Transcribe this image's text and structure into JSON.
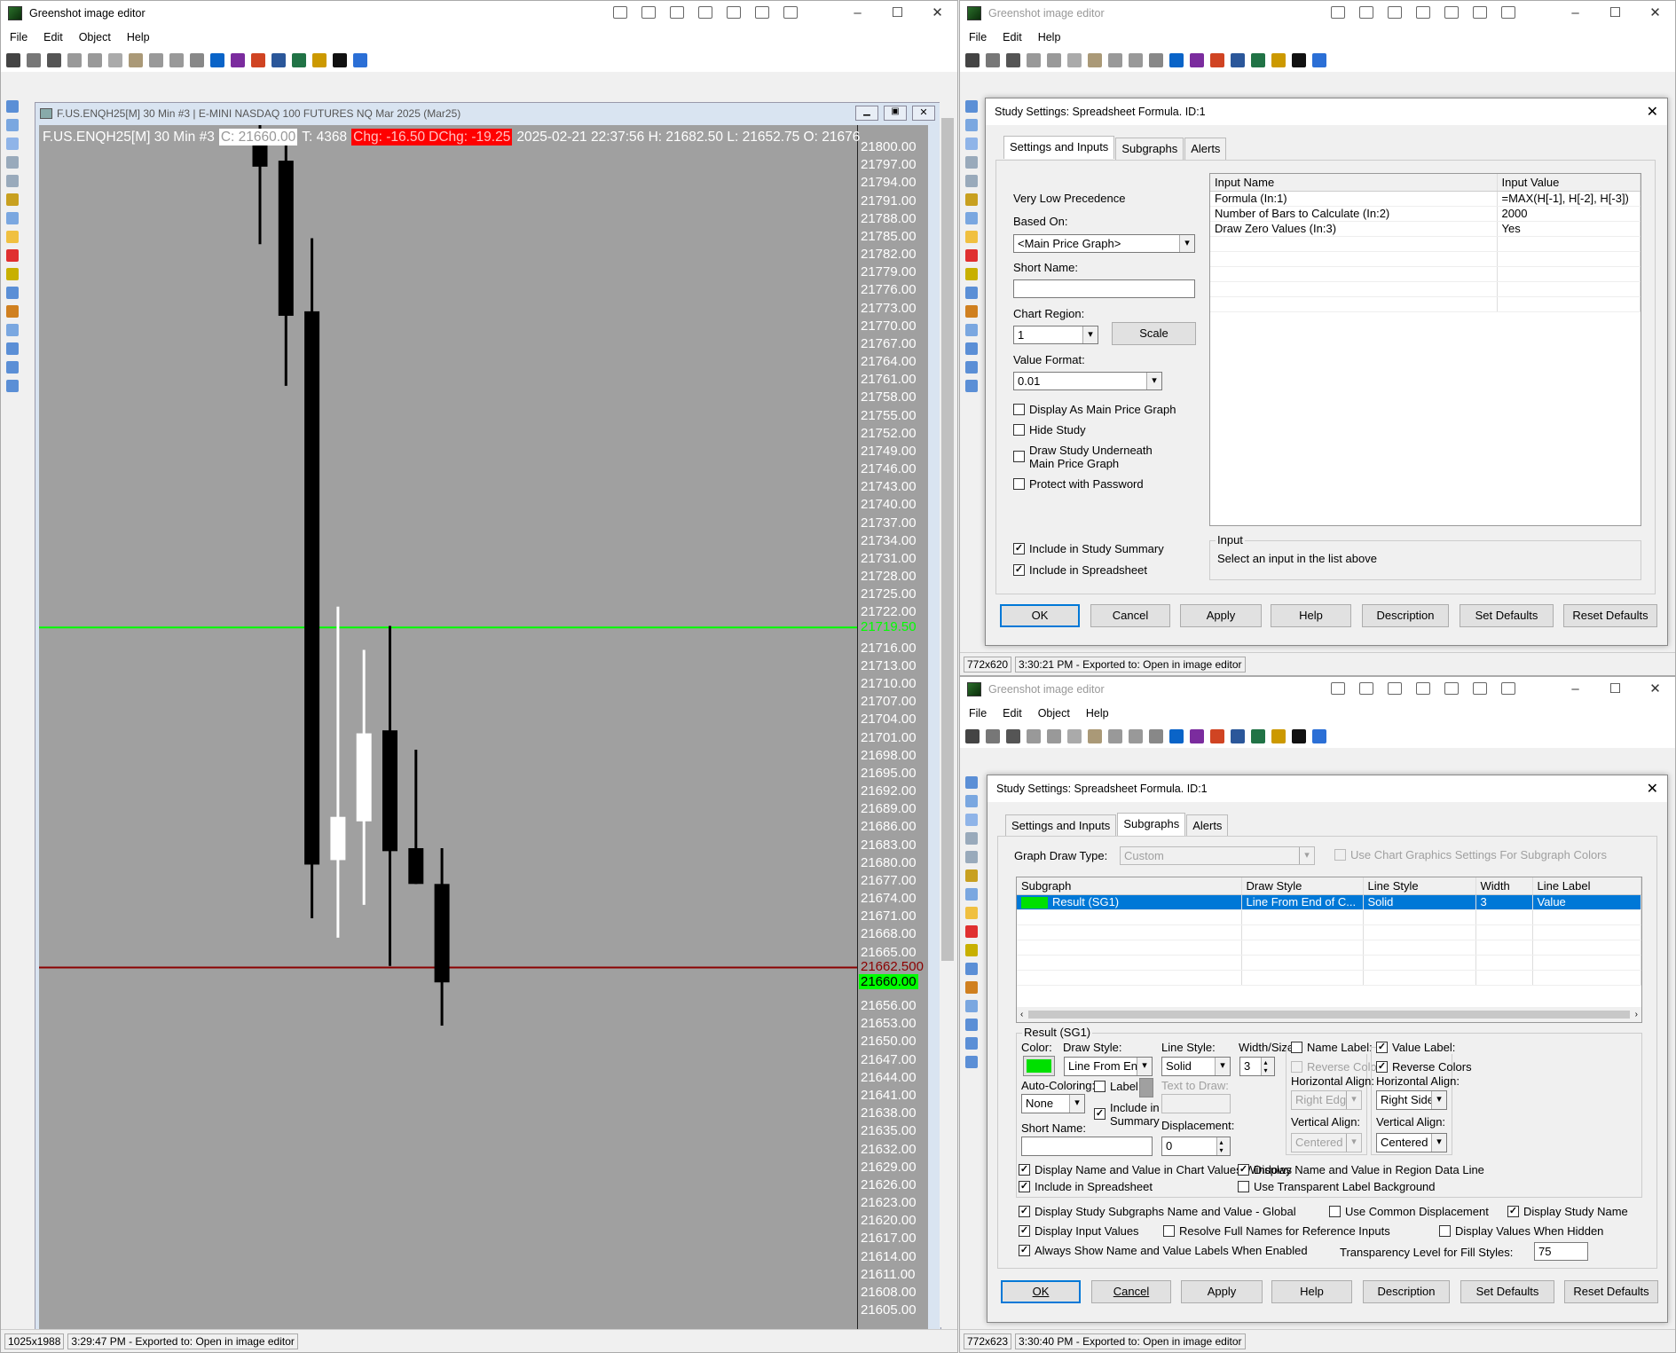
{
  "toolbar_icons": [
    {
      "n": "save-icon",
      "c": "#444"
    },
    {
      "n": "copy-icon",
      "c": "#777"
    },
    {
      "n": "print-icon",
      "c": "#555"
    },
    {
      "n": "delete-icon",
      "c": "#999"
    },
    {
      "n": "cut-icon",
      "c": "#999"
    },
    {
      "n": "copy-clipboard-icon",
      "c": "#aaa"
    },
    {
      "n": "paste-icon",
      "c": "#a97"
    },
    {
      "n": "undo-icon",
      "c": "#999"
    },
    {
      "n": "redo-icon",
      "c": "#999"
    },
    {
      "n": "settings-icon",
      "c": "#888"
    },
    {
      "n": "outlook-icon",
      "c": "#0a64c8"
    },
    {
      "n": "onenote-icon",
      "c": "#7b2c9e"
    },
    {
      "n": "powerpoint-icon",
      "c": "#d04423"
    },
    {
      "n": "word-icon",
      "c": "#2b579a"
    },
    {
      "n": "excel-icon",
      "c": "#217346"
    },
    {
      "n": "plugin-icon",
      "c": "#c90"
    },
    {
      "n": "info-icon",
      "c": "#111"
    },
    {
      "n": "help-icon",
      "c": "#2b6fd6"
    }
  ],
  "strip_icons": [
    "cursor-icon",
    "rectangle-icon",
    "ellipse-icon",
    "line-icon",
    "arrow-icon",
    "freehand-icon",
    "text-icon",
    "speechbubble-icon",
    "counter-icon",
    "highlight-icon",
    "obfuscate-icon",
    "crop-icon",
    "resize-icon",
    "rotate-icon",
    "flip-icon",
    "image-icon"
  ],
  "left": {
    "title": "Greenshot image editor",
    "menu": [
      "File",
      "Edit",
      "Object",
      "Help"
    ],
    "chart_window_title": "F.US.ENQH25[M]  30 Min  #3 | E-MINI NASDAQ 100 FUTURES NQ Mar 2025 (Mar25)",
    "header": {
      "symbol": "F.US.ENQH25[M]  30 Min  #3",
      "close": "C: 21660.00",
      "trades": "T: 4368",
      "chg": "Chg: -16.50",
      "dchg": "DChg: -19.25",
      "rest": "2025-02-21 22:37:56 H: 21682.50 L: 21652.75 O: 21676"
    },
    "status": {
      "size": "1025x1988",
      "msg": "3:29:47 PM - Exported to: Open in image editor"
    }
  },
  "chart_data": {
    "type": "candlestick",
    "ylim": [
      21602,
      21806
    ],
    "ticks": [
      21800,
      21797,
      21794,
      21791,
      21788,
      21785,
      21782,
      21779,
      21776,
      21773,
      21770,
      21767,
      21764,
      21761,
      21758,
      21755,
      21752,
      21749,
      21746,
      21743,
      21740,
      21737,
      21734,
      21731,
      21728,
      21725,
      21722,
      21716,
      21713,
      21710,
      21707,
      21704,
      21701,
      21698,
      21695,
      21692,
      21689,
      21686,
      21683,
      21680,
      21677,
      21674,
      21671,
      21668,
      21665,
      21656,
      21653,
      21650,
      21647,
      21644,
      21641,
      21638,
      21635,
      21632,
      21629,
      21626,
      21623,
      21620,
      21617,
      21614,
      21611,
      21608,
      21605
    ],
    "candles": [
      {
        "o": 21801,
        "h": 21806,
        "l": 21783.75,
        "c": 21796.75
      },
      {
        "o": 21797.75,
        "h": 21801,
        "l": 21760,
        "c": 21771.75
      },
      {
        "o": 21772.5,
        "h": 21784.75,
        "l": 21670.75,
        "c": 21679.75
      },
      {
        "o": 21680.5,
        "h": 21723,
        "l": 21667.5,
        "c": 21687.75
      },
      {
        "o": 21687,
        "h": 21715.75,
        "l": 21673,
        "c": 21701.75
      },
      {
        "o": 21702.25,
        "h": 21719.75,
        "l": 21662.75,
        "c": 21682
      },
      {
        "o": 21682.5,
        "h": 21699,
        "l": 21676.5,
        "c": 21676.5
      },
      {
        "o": 21676.5,
        "h": 21682.5,
        "l": 21652.75,
        "c": 21660
      }
    ],
    "lines": [
      {
        "value": 21719.5,
        "label": "21719.50",
        "color": "#00ff00"
      },
      {
        "value": 21662.5,
        "label": "21662.500",
        "color": "#8b0000"
      }
    ],
    "last_price": {
      "value": 21660,
      "label": "21660.00",
      "color": "#00ff00"
    }
  },
  "top": {
    "title": "Greenshot image editor",
    "menu": [
      "File",
      "Edit",
      "Help"
    ],
    "dialog_title": "Study Settings: Spreadsheet Formula. ID:1",
    "tabs": [
      "Settings and Inputs",
      "Subgraphs",
      "Alerts"
    ],
    "precedence": "Very Low Precedence",
    "based_on_label": "Based On:",
    "based_on": "<Main Price Graph>",
    "short_name_label": "Short Name:",
    "short_name": "",
    "chart_region_label": "Chart Region:",
    "chart_region": "1",
    "scale": "Scale",
    "value_format_label": "Value Format:",
    "value_format": "0.01",
    "checks": [
      {
        "label": "Display As Main Price Graph",
        "checked": false
      },
      {
        "label": "Hide Study",
        "checked": false
      },
      {
        "label": "Draw Study Underneath",
        "label2": "Main Price Graph",
        "checked": false
      },
      {
        "label": "Protect with Password",
        "checked": false
      },
      {
        "label": "Include in Study Summary",
        "checked": true
      },
      {
        "label": "Include in Spreadsheet",
        "checked": true
      }
    ],
    "inputs_header": [
      "Input Name",
      "Input Value"
    ],
    "inputs": [
      [
        "Formula   (In:1)",
        "=MAX(H[-1], H[-2], H[-3])"
      ],
      [
        "Number of Bars to Calculate   (In:2)",
        "2000"
      ],
      [
        "Draw Zero Values   (In:3)",
        "Yes"
      ]
    ],
    "input_group": "Input",
    "input_hint": "Select an input in the list above",
    "buttons": [
      "OK",
      "Cancel",
      "Apply",
      "Help",
      "Description",
      "Set Defaults",
      "Reset Defaults"
    ],
    "status": {
      "size": "772x620",
      "msg": "3:30:21 PM - Exported to: Open in image editor"
    }
  },
  "bottom": {
    "title": "Greenshot image editor",
    "menu": [
      "File",
      "Edit",
      "Object",
      "Help"
    ],
    "dialog_title": "Study Settings: Spreadsheet Formula. ID:1",
    "tabs": [
      "Settings and Inputs",
      "Subgraphs",
      "Alerts"
    ],
    "graph_draw_type_label": "Graph Draw Type:",
    "graph_draw_type": "Custom",
    "use_chart_graphics": {
      "label": "Use Chart Graphics Settings For Subgraph Colors",
      "checked": false
    },
    "subgraph_header": [
      "Subgraph",
      "Draw Style",
      "Line Style",
      "Width",
      "Line Label"
    ],
    "subgraph_row": [
      "Result (SG1)",
      "Line From End of C...",
      "Solid",
      "3",
      "Value"
    ],
    "subgraph_color": "#00e000",
    "group": "Result (SG1)",
    "color_label": "Color:",
    "draw_style_label": "Draw Style:",
    "draw_style": "Line From End of Ch",
    "line_style_label": "Line Style:",
    "line_style": "Solid",
    "width_label": "Width/Size:",
    "width": "3",
    "auto_coloring_label": "Auto-Coloring:",
    "auto_coloring": "None",
    "label_cb": {
      "label": "Label",
      "checked": false
    },
    "include_summary": {
      "label": "Include in",
      "label2": "Summary",
      "checked": true
    },
    "text_to_draw_label": "Text to Draw:",
    "short_name_label": "Short Name:",
    "displacement_label": "Displacement:",
    "displacement": "0",
    "name_label": {
      "label": "Name Label:",
      "checked": false,
      "reverse": "Reverse Colors",
      "reverse_checked": false,
      "halign_label": "Horizontal Align:",
      "halign": "Right Edge",
      "valign_label": "Vertical Align:",
      "valign": "Centered"
    },
    "value_label": {
      "label": "Value Label:",
      "checked": true,
      "reverse": "Reverse Colors",
      "reverse_checked": true,
      "halign_label": "Horizontal Align:",
      "halign": "Right Side Valu",
      "valign_label": "Vertical Align:",
      "valign": "Centered"
    },
    "group_checks": [
      {
        "label": "Display Name and Value in Chart Values Windows",
        "checked": true
      },
      {
        "label": "Display Name and Value in Region Data Line",
        "checked": true
      },
      {
        "label": "Include in Spreadsheet",
        "checked": true
      },
      {
        "label": "Use Transparent Label Background",
        "checked": false
      }
    ],
    "global_checks": [
      {
        "label": "Display Study Subgraphs Name and Value - Global",
        "checked": true
      },
      {
        "label": "Use Common Displacement",
        "checked": false
      },
      {
        "label": "Display Study Name",
        "checked": true
      },
      {
        "label": "Display Input Values",
        "checked": true
      },
      {
        "label": "Resolve Full Names for Reference Inputs",
        "checked": false
      },
      {
        "label": "Display Values When Hidden",
        "checked": false
      },
      {
        "label": "Always Show Name and Value Labels When Enabled",
        "checked": true
      }
    ],
    "transparency_label": "Transparency Level for Fill Styles:",
    "transparency": "75",
    "buttons": [
      "OK",
      "Cancel",
      "Apply",
      "Help",
      "Description",
      "Set Defaults",
      "Reset Defaults"
    ],
    "status": {
      "size": "772x623",
      "msg": "3:30:40 PM - Exported to: Open in image editor"
    }
  }
}
